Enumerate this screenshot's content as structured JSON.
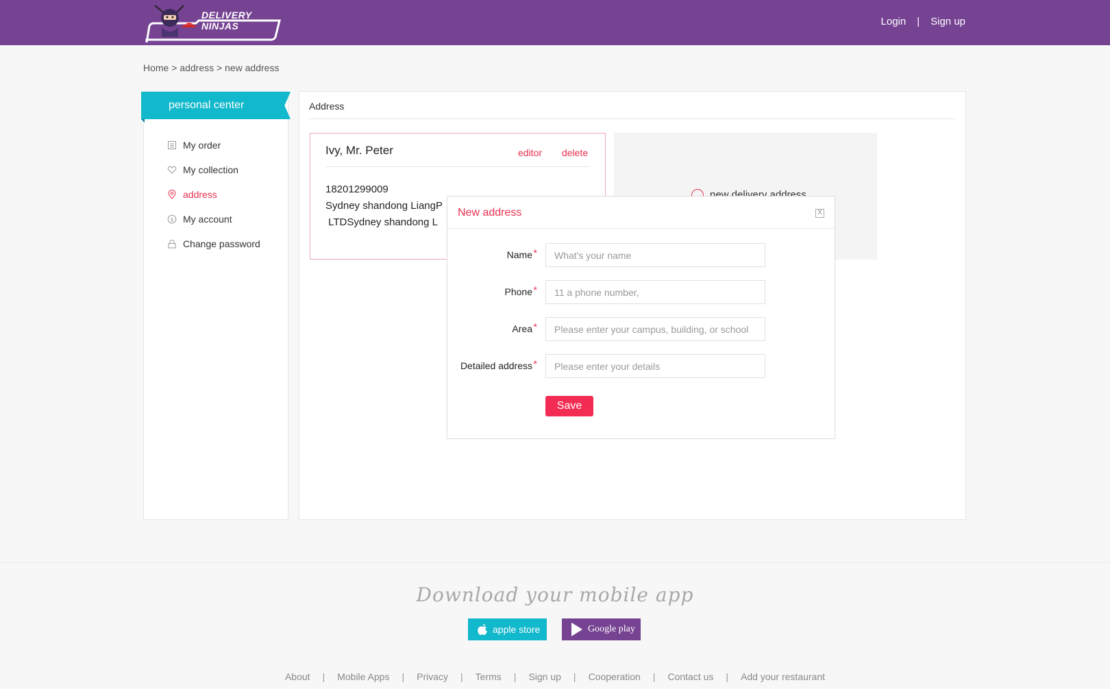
{
  "header": {
    "logo_text": "DELIVERY NINJAS",
    "login": "Login",
    "separator": "|",
    "signup": "Sign up"
  },
  "breadcrumb": "Home > address > new address",
  "sidebar": {
    "title": "personal center",
    "items": [
      {
        "label": "My order",
        "icon": "order-list-icon"
      },
      {
        "label": "My collection",
        "icon": "heart-icon"
      },
      {
        "label": "address",
        "icon": "location-pin-icon",
        "active": true
      },
      {
        "label": "My account",
        "icon": "dollar-icon"
      },
      {
        "label": "Change password",
        "icon": "lock-icon"
      }
    ]
  },
  "main": {
    "title": "Address",
    "address_card": {
      "name": "Ivy, Mr. Peter",
      "edit": "editor",
      "delete": "delete",
      "phone": "18201299009",
      "line1": "Sydney shandong LiangP",
      "line2": " LTDSydney shandong L"
    },
    "new_card_label": "new delivery address"
  },
  "modal": {
    "title": "New address",
    "close": "X",
    "fields": [
      {
        "label": "Name",
        "placeholder": "What's your name"
      },
      {
        "label": "Phone",
        "placeholder": "11 a phone number,"
      },
      {
        "label": "Area",
        "placeholder": "Please enter your campus, building, or school"
      },
      {
        "label": "Detailed address",
        "placeholder": "Please enter your details"
      }
    ],
    "required_mark": "*",
    "save": "Save"
  },
  "footer": {
    "download": "Download your mobile app",
    "apple": "apple store",
    "google": "Google play",
    "links": [
      "About",
      "Mobile Apps",
      "Privacy",
      "Terms",
      "Sign up",
      "Cooperation",
      "Contact us",
      "Add your restaurant"
    ]
  },
  "colors": {
    "brand_purple": "#764393",
    "accent_cyan": "#12b8cc",
    "accent_red": "#e8304f"
  }
}
